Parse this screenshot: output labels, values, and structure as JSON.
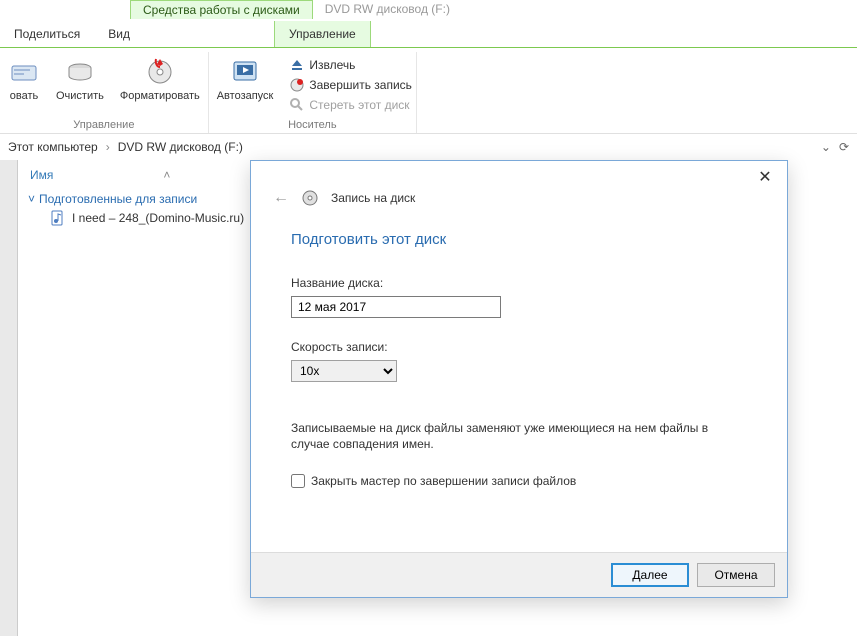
{
  "context_tab": "Средства работы с дисками",
  "context_title": "DVD RW дисковод (F:)",
  "tabs": {
    "share": "Поделиться",
    "view": "Вид",
    "manage": "Управление"
  },
  "ribbon": {
    "group_manage": "Управление",
    "rename": "овать",
    "clear": "Очистить",
    "format": "Форматировать",
    "autorun": "Автозапуск",
    "group_media": "Носитель",
    "eject": "Извлечь",
    "finalize": "Завершить запись",
    "erase": "Стереть этот диск"
  },
  "breadcrumb": {
    "root": "Этот компьютер",
    "leaf": "DVD RW дисковод (F:)"
  },
  "list": {
    "col_name": "Имя",
    "group": "Подготовленные для записи",
    "file": "I need – 248_(Domino-Music.ru)"
  },
  "dialog": {
    "header_title": "Запись на диск",
    "heading": "Подготовить этот диск",
    "name_label": "Название диска:",
    "name_value": "12 мая 2017",
    "speed_label": "Скорость записи:",
    "speed_value": "10x",
    "note": "Записываемые на диск файлы заменяют уже имеющиеся на нем файлы в случае совпадения имен.",
    "close_checkbox": "Закрыть мастер по завершении записи файлов",
    "next": "Далее",
    "cancel": "Отмена"
  }
}
